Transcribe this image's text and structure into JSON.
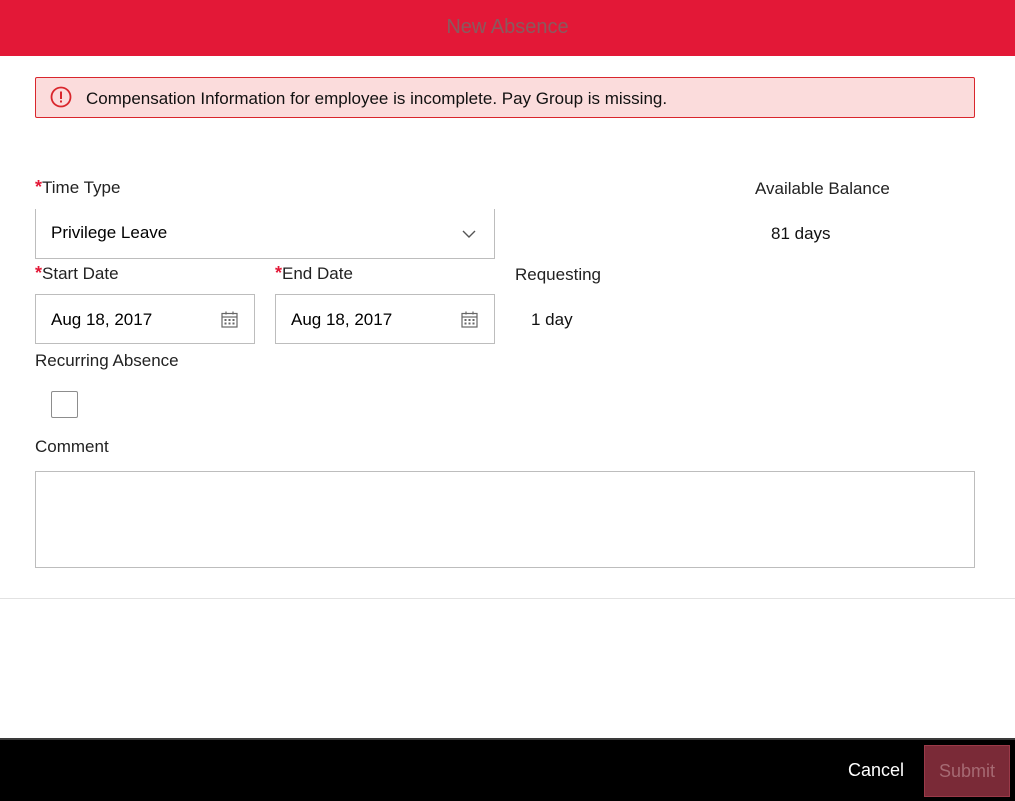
{
  "header": {
    "title": "New Absence"
  },
  "error": {
    "message": "Compensation Information for employee is incomplete. Pay Group is missing.",
    "color": "#d9262c"
  },
  "form": {
    "required_mark": "*",
    "time_type": {
      "label": "Time Type",
      "value": "Privilege Leave",
      "icon": "chevron-down-icon"
    },
    "available_balance": {
      "label": "Available Balance",
      "value": "81 days"
    },
    "start_date": {
      "label": "Start Date",
      "value": "Aug 18, 2017",
      "icon": "calendar-icon"
    },
    "end_date": {
      "label": "End Date",
      "value": "Aug 18, 2017",
      "icon": "calendar-icon"
    },
    "requesting": {
      "label": "Requesting",
      "value": "1 day"
    },
    "recurring": {
      "label": "Recurring Absence",
      "checked": false
    },
    "comment": {
      "label": "Comment",
      "value": ""
    }
  },
  "footer": {
    "cancel_label": "Cancel",
    "submit_label": "Submit"
  },
  "colors": {
    "brand": "#e31837",
    "footer_bg": "#000000",
    "submit_disabled_bg": "#7a2a37"
  }
}
